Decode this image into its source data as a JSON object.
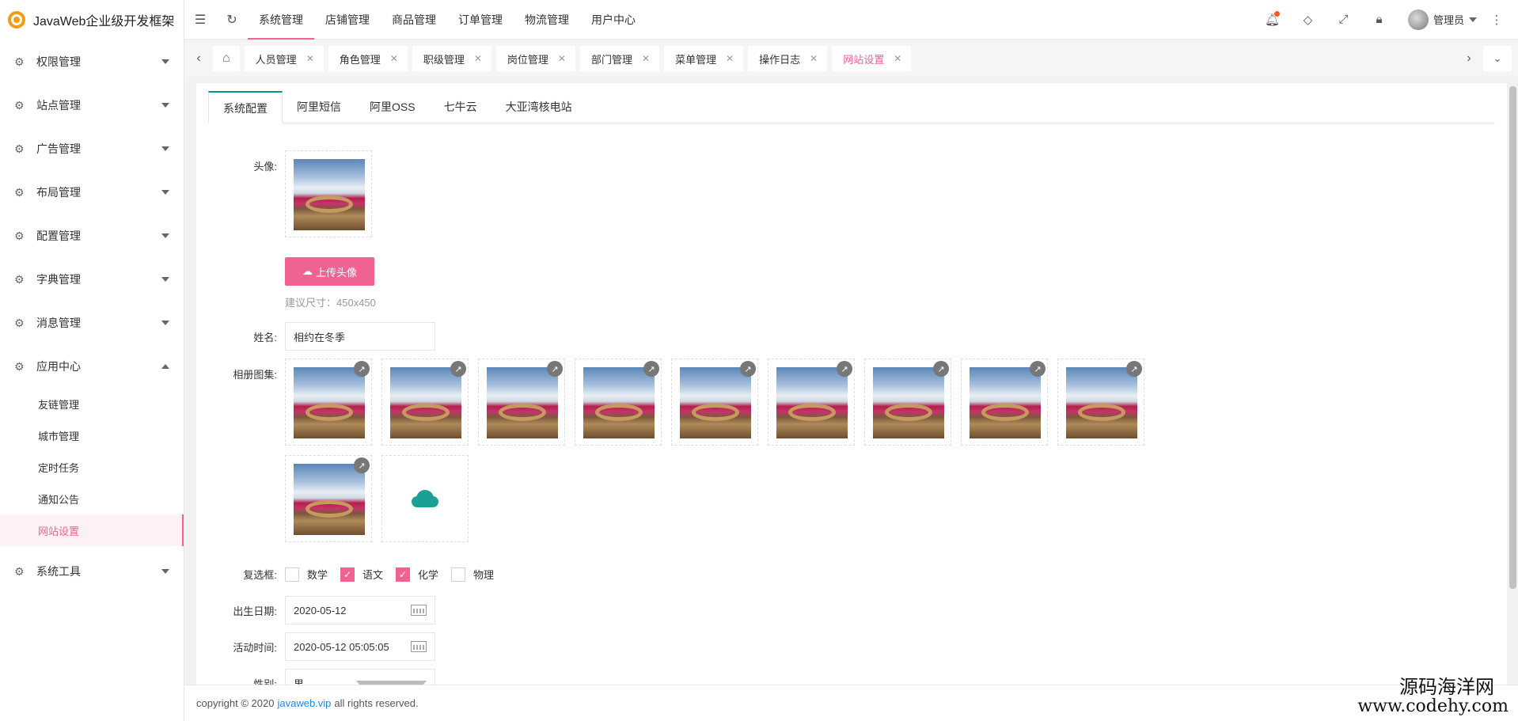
{
  "app": {
    "title": "JavaWeb企业级开发框架"
  },
  "sidebar": {
    "items": [
      {
        "label": "权限管理",
        "expanded": false
      },
      {
        "label": "站点管理",
        "expanded": false
      },
      {
        "label": "广告管理",
        "expanded": false
      },
      {
        "label": "布局管理",
        "expanded": false
      },
      {
        "label": "配置管理",
        "expanded": false
      },
      {
        "label": "字典管理",
        "expanded": false
      },
      {
        "label": "消息管理",
        "expanded": false
      },
      {
        "label": "应用中心",
        "expanded": true
      }
    ],
    "sub_items": [
      "友链管理",
      "城市管理",
      "定时任务",
      "通知公告",
      "网站设置"
    ],
    "last_item": "系统工具"
  },
  "topnav": {
    "items": [
      "系统管理",
      "店铺管理",
      "商品管理",
      "订单管理",
      "物流管理",
      "用户中心"
    ],
    "user": "管理员"
  },
  "tabs": {
    "items": [
      "人员管理",
      "角色管理",
      "职级管理",
      "岗位管理",
      "部门管理",
      "菜单管理",
      "操作日志",
      "网站设置"
    ]
  },
  "sub_tabs": [
    "系统配置",
    "阿里短信",
    "阿里OSS",
    "七牛云",
    "大亚湾核电站"
  ],
  "form": {
    "avatar_label": "头像:",
    "upload_label": "上传头像",
    "size_hint": "建议尺寸：450x450",
    "name_label": "姓名:",
    "name_value": "相约在冬季",
    "album_label": "相册图集:",
    "album_count": 10,
    "checkbox_label": "复选框:",
    "checkboxes": [
      {
        "label": "数学",
        "checked": false
      },
      {
        "label": "语文",
        "checked": true
      },
      {
        "label": "化学",
        "checked": true
      },
      {
        "label": "物理",
        "checked": false
      }
    ],
    "birthday_label": "出生日期:",
    "birthday_value": "2020-05-12",
    "activity_label": "活动时间:",
    "activity_value": "2020-05-12 05:05:05",
    "gender_label": "性别:",
    "gender_value": "男"
  },
  "footer": {
    "prefix": "copyright © 2020",
    "link": "javaweb.vip",
    "suffix": "all rights reserved."
  },
  "watermark": {
    "line1": "源码海洋网",
    "line2": "www.codehy.com"
  },
  "colors": {
    "accent": "#f06292",
    "tab_active": "#009688"
  }
}
